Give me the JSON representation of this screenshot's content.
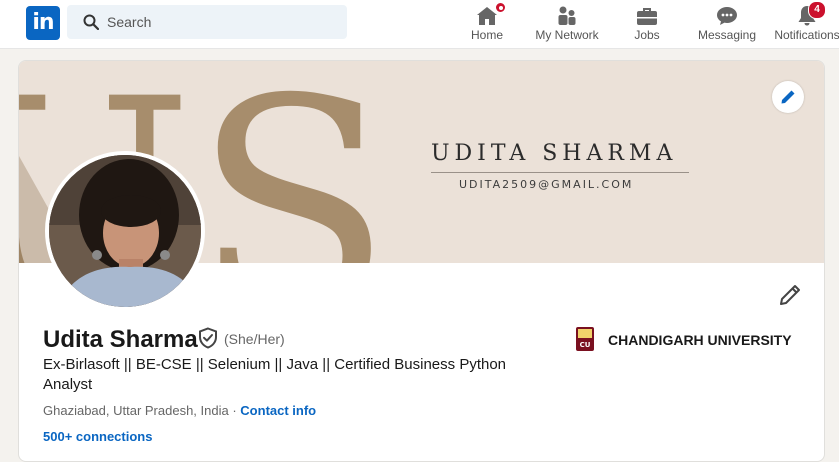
{
  "app": {
    "logo_text": "in",
    "brand_color": "#0a66c2",
    "notification_color": "#cb112d"
  },
  "search": {
    "placeholder": "Search",
    "value": ""
  },
  "nav": [
    {
      "label": "Home",
      "icon": "home-icon",
      "badge": "dot"
    },
    {
      "label": "My Network",
      "icon": "network-icon",
      "badge": ""
    },
    {
      "label": "Jobs",
      "icon": "briefcase-icon",
      "badge": ""
    },
    {
      "label": "Messaging",
      "icon": "messaging-icon",
      "badge": ""
    },
    {
      "label": "Notifications",
      "icon": "bell-icon",
      "badge": "4"
    }
  ],
  "banner": {
    "name": "UDITA SHARMA",
    "email": "UDITA2509@GMAIL.COM",
    "monogram": "US",
    "background_color": "#ebe1d8",
    "monogram_color": "#a78d6c"
  },
  "profile": {
    "name": "Udita Sharma",
    "pronouns": "(She/Her)",
    "headline": "Ex-Birlasoft || BE-CSE || Selenium || Java || Certified Business Python Analyst",
    "location": "Ghaziabad, Uttar Pradesh, India",
    "location_separator": " · ",
    "contact_info_label": "Contact info",
    "connections": "500+ connections",
    "education": "CHANDIGARH UNIVERSITY",
    "education_logo_text": "CU"
  }
}
